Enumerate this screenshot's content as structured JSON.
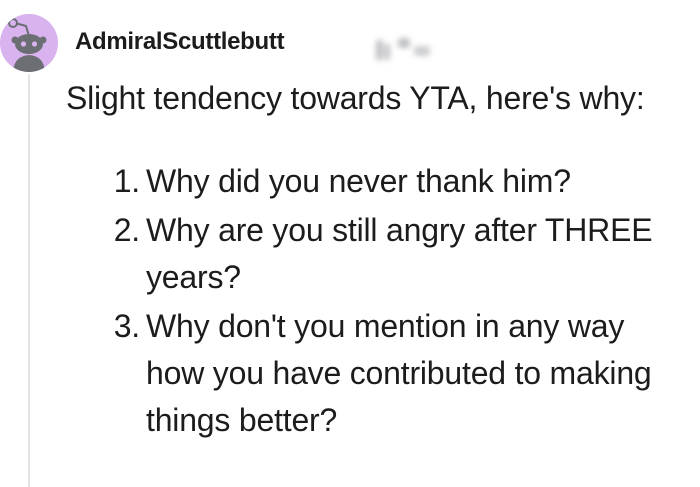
{
  "comment": {
    "author": "AdmiralScuttlebutt",
    "avatar_icon": "snoo-avatar-icon",
    "avatar_color": "#d9b3f0",
    "flair_icon": "blurred-flair-icon",
    "intro": "Slight tendency towards YTA, here's why:",
    "reasons": [
      {
        "number": "1.",
        "text": "Why did you never thank him?"
      },
      {
        "number": "2.",
        "text": "Why are you still angry after THREE years?"
      },
      {
        "number": "3.",
        "text": "Why don't you mention in any way how you have contributed to making things better?"
      }
    ]
  }
}
